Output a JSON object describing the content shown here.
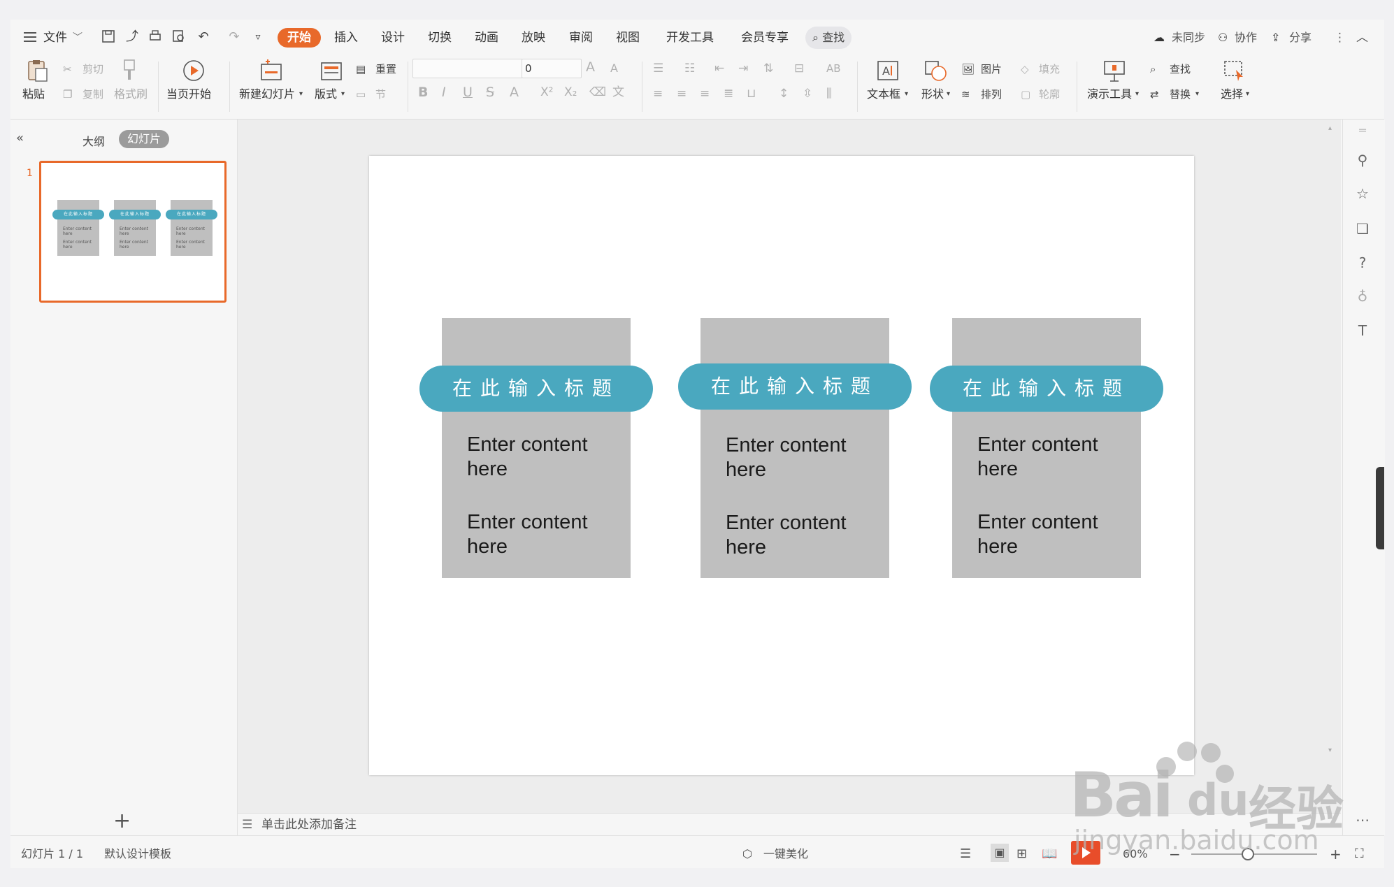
{
  "menu": {
    "file": "文件",
    "tabs": [
      "开始",
      "插入",
      "设计",
      "切换",
      "动画",
      "放映",
      "审阅",
      "视图",
      "开发工具",
      "会员专享"
    ],
    "active_tab": "开始",
    "search": "查找",
    "right": {
      "sync": "未同步",
      "collab": "协作",
      "share": "分享"
    }
  },
  "ribbon": {
    "paste": "粘贴",
    "cut": "剪切",
    "copy": "复制",
    "format_painter": "格式刷",
    "from_current": "当页开始",
    "new_slide": "新建幻灯片",
    "layout": "版式",
    "reset": "重置",
    "section": "节",
    "font_size": "0",
    "textbox": "文本框",
    "shape": "形状",
    "picture": "图片",
    "fill": "填充",
    "arrange": "排列",
    "outline": "轮廓",
    "present_tools": "演示工具",
    "find": "查找",
    "replace": "替换",
    "select": "选择"
  },
  "panel": {
    "outline_tab": "大纲",
    "slides_tab": "幻灯片",
    "slide_number": "1"
  },
  "slide": {
    "cards": [
      {
        "title": "在此输入标题",
        "line1": "Enter content here",
        "line2": "Enter content here"
      },
      {
        "title": "在此输入标题",
        "line1": "Enter content here",
        "line2": "Enter content here"
      },
      {
        "title": "在此输入标题",
        "line1": "Enter content here",
        "line2": "Enter content here"
      }
    ],
    "card_color": "#bfbfbf",
    "pill_color": "#4aa8bf"
  },
  "notes": {
    "placeholder": "单击此处添加备注"
  },
  "status": {
    "slide_count": "幻灯片 1 / 1",
    "template": "默认设计模板",
    "beautify": "一键美化",
    "zoom": "60%"
  },
  "watermark": {
    "brand": "Bai",
    "brand2": "du",
    "cn": "经验",
    "url": "jingyan.baidu.com"
  },
  "accent": "#e8692a"
}
